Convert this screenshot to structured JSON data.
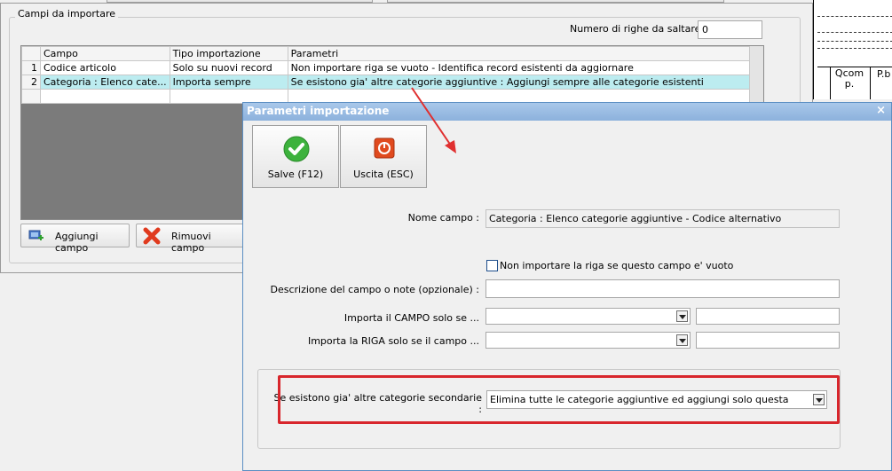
{
  "background": {
    "group_title": "Campi da importare",
    "skip_rows_label": "Numero di righe da saltare  :",
    "skip_rows_value": "0",
    "grid": {
      "headers": [
        "Campo",
        "Tipo importazione",
        "Parametri"
      ],
      "rows": [
        {
          "num": "1",
          "campo": "Codice articolo",
          "tipo": "Solo su nuovi record",
          "parametri": "Non importare riga se vuoto - Identifica record esistenti da aggiornare"
        },
        {
          "num": "2",
          "campo": "Categoria : Elenco cate...",
          "tipo": "Importa sempre",
          "parametri": "Se esistono gia' altre categorie aggiuntive : Aggiungi sempre alle categorie esistenti"
        }
      ]
    },
    "add_button": "Aggiungi campo",
    "remove_button": "Rimuovi campo",
    "report_headers": [
      "Qcom p.",
      "P.b"
    ]
  },
  "dialog": {
    "title": "Parametri importazione",
    "close_glyph": "×",
    "save_button": "Salve (F12)",
    "exit_button": "Uscita (ESC)",
    "field_name_label": "Nome campo  :",
    "field_name_value": "Categoria : Elenco categorie aggiuntive - Codice alternativo",
    "skip_empty_checkbox_label": "Non importare la riga se questo campo e' vuoto",
    "skip_empty_checked": false,
    "description_label": "Descrizione del campo o note (opzionale)  :",
    "description_value": "",
    "import_field_if_label": "Importa il CAMPO solo se ...",
    "import_field_if_value": "",
    "import_field_if_extra": "",
    "import_row_if_label": "Importa la RIGA solo se il campo ...",
    "import_row_if_value": "",
    "import_row_if_extra": "",
    "secondary_categories_label": "Se esistono gia' altre categorie secondarie  :",
    "secondary_categories_value": "Elimina tutte le categorie aggiuntive ed aggiungi solo questa"
  },
  "colors": {
    "selected_row": "#bcecf0",
    "highlight_border": "#d8262c",
    "arrow": "#e03030",
    "dialog_title": "#8cb1dc"
  },
  "icons": [
    "checkmark-icon",
    "exit-icon",
    "add-field-icon",
    "remove-x-icon",
    "dropdown-icon",
    "close-icon"
  ]
}
